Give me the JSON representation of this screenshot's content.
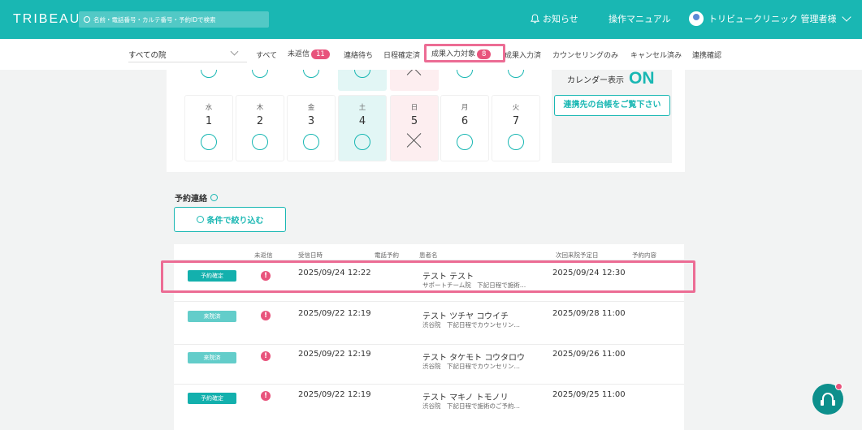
{
  "header": {
    "logo": "TRIBEAU",
    "search_placeholder": "名前・電話番号・カルテ番号・予約IDで検索",
    "notifications": "お知らせ",
    "manual": "操作マニュアル",
    "user": "トリビュークリニック 管理者様"
  },
  "filterbar": {
    "clinic_select": "すべての院",
    "tabs": [
      {
        "label": "すべて"
      },
      {
        "label": "未返信",
        "badge": "11"
      },
      {
        "label": "連絡待ち"
      },
      {
        "label": "日程確定済"
      },
      {
        "label": "成果入力対象",
        "badge": "8"
      },
      {
        "label": "成果入力済"
      },
      {
        "label": "カウンセリングのみ"
      },
      {
        "label": "キャンセル済み"
      },
      {
        "label": "連携確認"
      }
    ]
  },
  "calendar": {
    "days": [
      {
        "dow": "水",
        "num": "1",
        "mark": "circle"
      },
      {
        "dow": "木",
        "num": "2",
        "mark": "circle"
      },
      {
        "dow": "金",
        "num": "3",
        "mark": "circle"
      },
      {
        "dow": "土",
        "num": "4",
        "mark": "circle"
      },
      {
        "dow": "日",
        "num": "5",
        "mark": "cross"
      },
      {
        "dow": "月",
        "num": "6",
        "mark": "circle"
      },
      {
        "dow": "火",
        "num": "7",
        "mark": "circle"
      }
    ],
    "display_label": "カレンダー表示",
    "display_state": "ON",
    "ledger_button": "連携先の台帳をご覧下さい"
  },
  "contacts": {
    "title": "予約連絡",
    "filter_button": "条件で絞り込む",
    "columns": [
      "未返信",
      "受信日時",
      "電話予約",
      "患者名",
      "次回来院予定日",
      "予約内容"
    ],
    "rows": [
      {
        "status": "予約確定",
        "received": "2025/09/24 12:22",
        "name": "テスト テスト",
        "sub": "サポートチーム院　下記日程で施術…",
        "next": "2025/09/24 12:30"
      },
      {
        "status": "来院済",
        "received": "2025/09/22 12:19",
        "name": "テスト ツチヤ コウイチ",
        "sub": "渋谷院　下記日程でカウンセリン…",
        "next": "2025/09/28 11:00"
      },
      {
        "status": "来院済",
        "received": "2025/09/22 12:19",
        "name": "テスト タケモト コウタロウ",
        "sub": "渋谷院　下記日程でカウンセリン…",
        "next": "2025/09/26 11:00"
      },
      {
        "status": "予約確定",
        "received": "2025/09/22 12:19",
        "name": "テスト マキノ トモノリ",
        "sub": "渋谷院　下記日程で施術のご予約…",
        "next": "2025/09/25 11:00"
      }
    ],
    "alert_mark": "!"
  }
}
